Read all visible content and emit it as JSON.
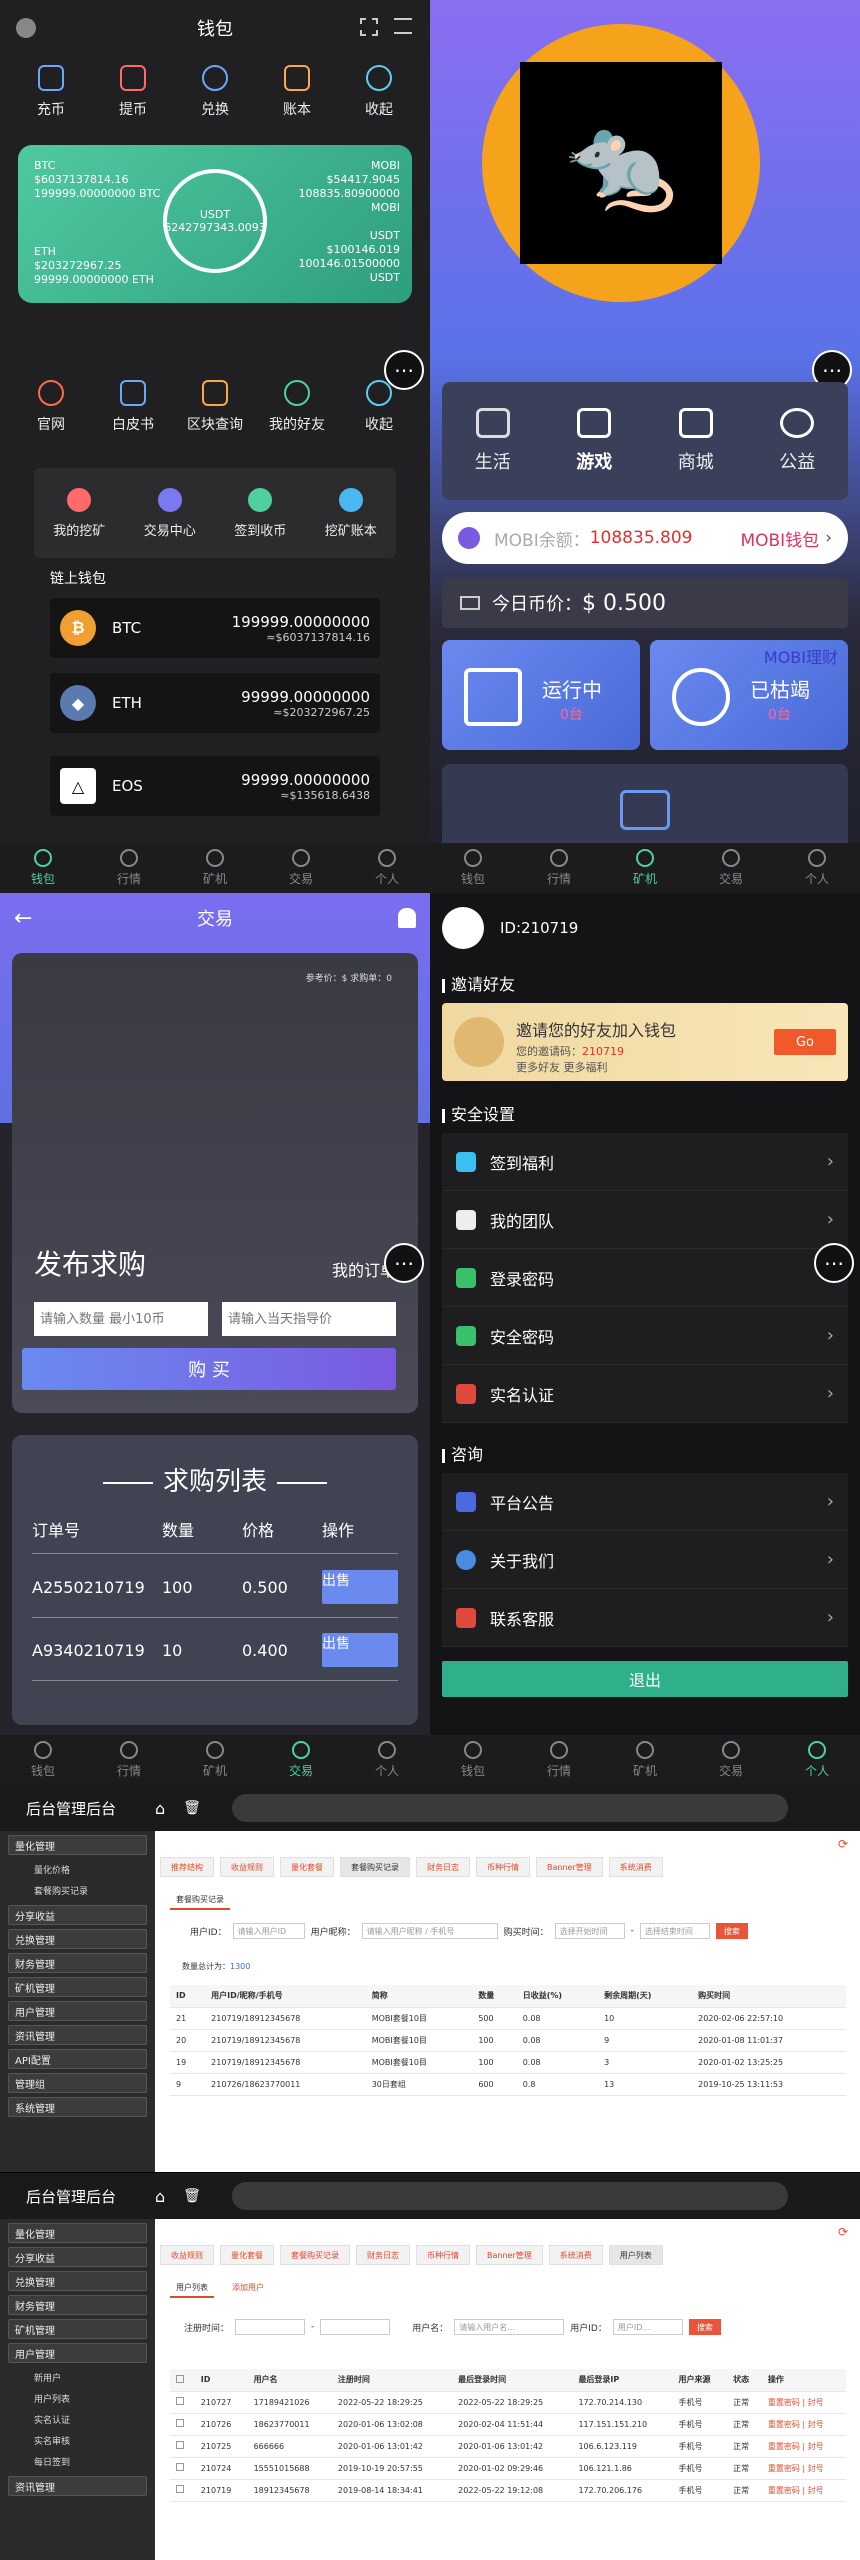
{
  "tabbar": [
    "钱包",
    "行情",
    "矿机",
    "交易",
    "个人"
  ],
  "wallet": {
    "title": "钱包",
    "actions": [
      "充币",
      "提币",
      "兑换",
      "账本",
      "收起"
    ],
    "card": {
      "btc_label": "BTC",
      "btc_usd": "$6037137814.16",
      "btc_amount": "199999.00000000 BTC",
      "eth_label": "ETH",
      "eth_usd": "$203272967.25",
      "eth_amount": "99999.00000000 ETH",
      "mobi_label": "MOBI",
      "mobi_usd": "$54417.9045",
      "mobi_amount": "108835.80900000",
      "mobi_unit": "MOBI",
      "usdt_label": "USDT",
      "usdt_usd": "$100146.019",
      "usdt_amount": "100146.01500000",
      "usdt_unit": "USDT",
      "center_label": "USDT",
      "center_value": "6242797343.0093"
    },
    "links": [
      "官网",
      "白皮书",
      "区块查询",
      "我的好友",
      "收起"
    ],
    "services": [
      "我的挖矿",
      "交易中心",
      "签到收币",
      "挖矿账本"
    ],
    "chain_title": "链上钱包",
    "chain": [
      {
        "name": "BTC",
        "amount": "199999.00000000",
        "usd": "≈$6037137814.16"
      },
      {
        "name": "ETH",
        "amount": "99999.00000000",
        "usd": "≈$203272967.25"
      },
      {
        "name": "EOS",
        "amount": "99999.00000000",
        "usd": "≈$135618.6438"
      }
    ]
  },
  "mining": {
    "services": [
      "生活",
      "游戏",
      "商城",
      "公益"
    ],
    "mobi_balance_label": "MOBI余额：",
    "mobi_balance": "108835.809",
    "mobi_wallet": "MOBI钱包",
    "today_price_label": "今日币价：",
    "today_price": "$ 0.500",
    "mobi_finance": "MOBI理财",
    "running_label": "运行中",
    "running_count": "0台",
    "dead_label": "已枯竭",
    "dead_count": "0台"
  },
  "trade": {
    "title": "交易",
    "ref": "参考价：$  求购单：0",
    "publish": "发布求购",
    "my_orders": "我的订单",
    "qty_placeholder": "请输入数量 最小10币",
    "price_placeholder": "请输入当天指导价",
    "buy": "购 买",
    "list_title": "求购列表",
    "headers": [
      "订单号",
      "数量",
      "价格",
      "操作"
    ],
    "rows": [
      {
        "id": "A2550210719",
        "qty": "100",
        "price": "0.500",
        "action": "出售"
      },
      {
        "id": "A9340210719",
        "qty": "10",
        "price": "0.400",
        "action": "出售"
      }
    ]
  },
  "profile": {
    "user_id": "ID:210719",
    "invite_section": "邀请好友",
    "invite_title": "邀请您的好友加入钱包",
    "invite_code_label": "您的邀请码：",
    "invite_code": "210719",
    "invite_more": "更多好友 更多福利",
    "go": "Go",
    "security_section": "安全设置",
    "security_items": [
      "签到福利",
      "我的团队",
      "登录密码",
      "安全密码",
      "实名认证"
    ],
    "consult_section": "咨询",
    "consult_items": [
      "平台公告",
      "关于我们",
      "联系客服"
    ],
    "logout": "退出"
  },
  "admin1": {
    "title": "后台管理后台",
    "side": [
      "量化管理",
      "分享收益",
      "兑换管理",
      "财务管理",
      "矿机管理",
      "用户管理",
      "资讯管理",
      "API配置",
      "管理组",
      "系统管理"
    ],
    "side_sub": [
      "量化价格",
      "套餐购买记录"
    ],
    "tabs": [
      "推荐结构",
      "收益规则",
      "量化套餐",
      "套餐购买记录",
      "财务日志",
      "币种行情",
      "Banner管理",
      "系统消费"
    ],
    "subtab": "套餐购买记录",
    "filter_user": "用户ID：",
    "filter_user_ph": "请输入用户ID",
    "filter_name": "用户昵称：",
    "filter_name_ph": "请输入用户昵称 / 手机号",
    "filter_time": "购买时间：",
    "filter_start": "选择开始时间",
    "filter_end": "选择结束时间",
    "search": "搜索",
    "total_label": "数量总计为：",
    "total": "1300",
    "headers": [
      "ID",
      "用户ID/昵称/手机号",
      "简称",
      "数量",
      "日收益(%)",
      "剩余周期(天)",
      "购买时间"
    ],
    "rows": [
      [
        "21",
        "210719/18912345678",
        "MOBI套餐10目",
        "500",
        "0.08",
        "10",
        "2020-02-06 22:57:10"
      ],
      [
        "20",
        "210719/18912345678",
        "MOBI套餐10目",
        "100",
        "0.08",
        "9",
        "2020-01-08 11:01:37"
      ],
      [
        "19",
        "210719/18912345678",
        "MOBI套餐10目",
        "100",
        "0.08",
        "3",
        "2020-01-02 13:25:25"
      ],
      [
        "9",
        "210726/18623770011",
        "30日套组",
        "600",
        "0.8",
        "13",
        "2019-10-25 13:11:53"
      ]
    ]
  },
  "admin2": {
    "title": "后台管理后台",
    "side": [
      "量化管理",
      "分享收益",
      "兑换管理",
      "财务管理",
      "矿机管理",
      "用户管理",
      "资讯管理"
    ],
    "side_sub": [
      "新用户",
      "用户列表",
      "实名认证",
      "实名审核",
      "每日签到"
    ],
    "tabs": [
      "收益规则",
      "量化套餐",
      "套餐购买记录",
      "财务日志",
      "币种行情",
      "Banner管理",
      "系统消费",
      "用户列表"
    ],
    "subtabs": [
      "用户列表",
      "添加用户"
    ],
    "filter_time": "注册时间：",
    "filter_name": "用户名：",
    "filter_name_ph": "请输入用户名...",
    "filter_user": "用户ID：",
    "filter_user_ph": "用户ID...",
    "search": "搜索",
    "headers": [
      "ID",
      "用户名",
      "注册时间",
      "最后登录时间",
      "最后登录IP",
      "用户来源",
      "状态",
      "操作"
    ],
    "rows": [
      [
        "210727",
        "17189421026",
        "2022-05-22 18:29:25",
        "2022-05-22 18:29:25",
        "172.70.214.130",
        "手机号",
        "正常",
        "重置密码 | 封号"
      ],
      [
        "210726",
        "18623770011",
        "2020-01-06 13:02:08",
        "2020-02-04 11:51:44",
        "117.151.151.210",
        "手机号",
        "正常",
        "重置密码 | 封号"
      ],
      [
        "210725",
        "666666",
        "2020-01-06 13:01:42",
        "2020-01-06 13:01:42",
        "106.6.123.119",
        "手机号",
        "正常",
        "重置密码 | 封号"
      ],
      [
        "210724",
        "15551015688",
        "2019-10-19 20:57:55",
        "2020-01-02 09:29:46",
        "106.121.1.86",
        "手机号",
        "正常",
        "重置密码 | 封号"
      ],
      [
        "210719",
        "18912345678",
        "2019-08-14 18:34:41",
        "2022-05-22 19:12:08",
        "172.70.206.176",
        "手机号",
        "正常",
        "重置密码 | 封号"
      ]
    ]
  }
}
